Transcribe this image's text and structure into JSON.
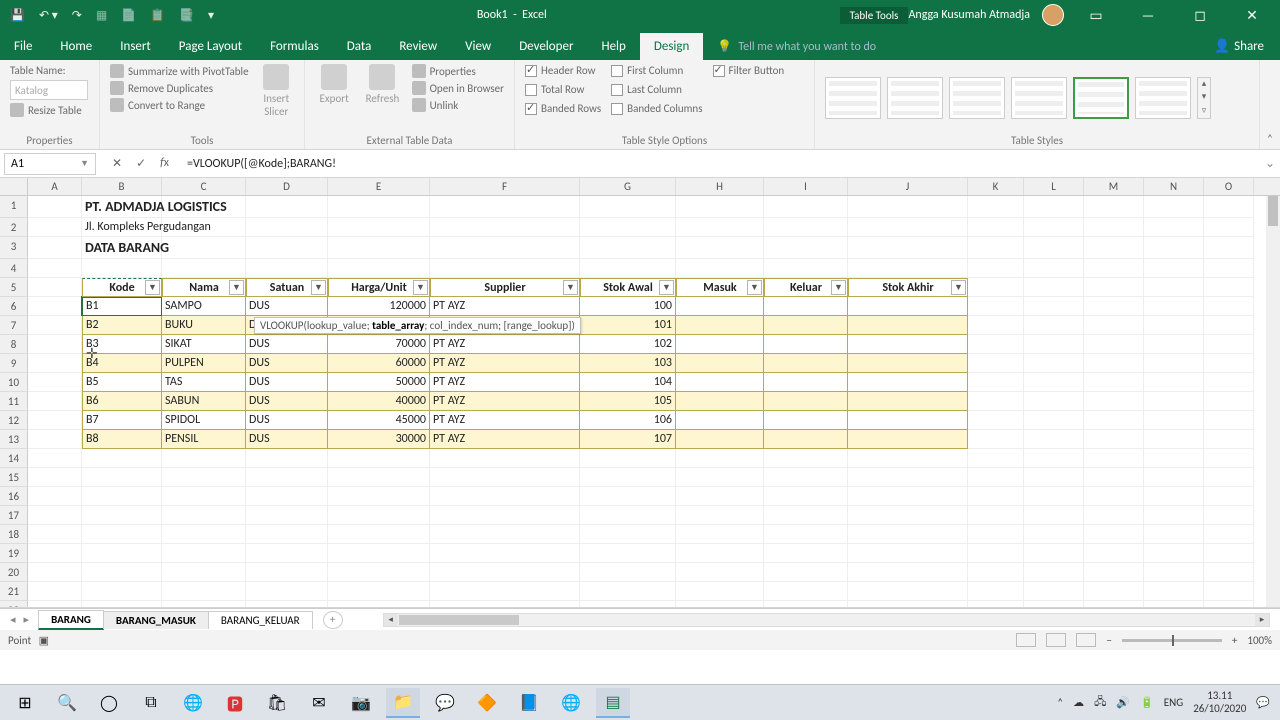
{
  "title": {
    "doc": "Book1",
    "app": "Excel",
    "tools": "Table Tools",
    "user": "Angga Kusumah Atmadja"
  },
  "tabs": [
    "File",
    "Home",
    "Insert",
    "Page Layout",
    "Formulas",
    "Data",
    "Review",
    "View",
    "Developer",
    "Help",
    "Design"
  ],
  "tellme": "Tell me what you want to do",
  "share": "Share",
  "ribbon": {
    "properties": {
      "label": "Properties",
      "tableNameLabel": "Table Name:",
      "tableName": "Katalog",
      "resize": "Resize Table"
    },
    "tools": {
      "label": "Tools",
      "pivot": "Summarize with PivotTable",
      "dup": "Remove Duplicates",
      "range": "Convert to Range",
      "slicer": "Insert Slicer"
    },
    "ext": {
      "label": "External Table Data",
      "export": "Export",
      "refresh": "Refresh",
      "props": "Properties",
      "browser": "Open in Browser",
      "unlink": "Unlink"
    },
    "opts": {
      "label": "Table Style Options",
      "header": "Header Row",
      "total": "Total Row",
      "banded": "Banded Rows",
      "first": "First Column",
      "last": "Last Column",
      "bandedc": "Banded Columns",
      "filter": "Filter Button"
    },
    "styles": {
      "label": "Table Styles"
    }
  },
  "fx": {
    "nameBox": "A1",
    "formula": "=VLOOKUP([@Kode];BARANG!"
  },
  "tooltip": "VLOOKUP(lookup_value; table_array; col_index_num; [range_lookup])",
  "columns": [
    "A",
    "B",
    "C",
    "D",
    "E",
    "F",
    "G",
    "H",
    "I",
    "J",
    "K",
    "L",
    "M",
    "N",
    "O"
  ],
  "sheet": {
    "title": "PT. ADMADJA LOGISTICS",
    "sub": "Jl. Kompleks Pergudangan",
    "section": "DATA BARANG",
    "headers": [
      "Kode",
      "Nama",
      "Satuan",
      "Harga/Unit",
      "Supplier",
      "Stok Awal",
      "Masuk",
      "Keluar",
      "Stok Akhir"
    ],
    "rows": [
      {
        "kode": "B1",
        "nama": "SAMPO",
        "sat": "DUS",
        "harga": "120000",
        "sup": "PT AYZ",
        "stok": "100"
      },
      {
        "kode": "B2",
        "nama": "BUKU",
        "sat": "DUS",
        "harga": "",
        "sup": "",
        "stok": "101"
      },
      {
        "kode": "B3",
        "nama": "SIKAT",
        "sat": "DUS",
        "harga": "70000",
        "sup": "PT AYZ",
        "stok": "102"
      },
      {
        "kode": "B4",
        "nama": "PULPEN",
        "sat": "DUS",
        "harga": "60000",
        "sup": "PT AYZ",
        "stok": "103"
      },
      {
        "kode": "B5",
        "nama": "TAS",
        "sat": "DUS",
        "harga": "50000",
        "sup": "PT AYZ",
        "stok": "104"
      },
      {
        "kode": "B6",
        "nama": "SABUN",
        "sat": "DUS",
        "harga": "40000",
        "sup": "PT AYZ",
        "stok": "105"
      },
      {
        "kode": "B7",
        "nama": "SPIDOL",
        "sat": "DUS",
        "harga": "45000",
        "sup": "PT AYZ",
        "stok": "106"
      },
      {
        "kode": "B8",
        "nama": "PENSIL",
        "sat": "DUS",
        "harga": "30000",
        "sup": "PT AYZ",
        "stok": "107"
      }
    ]
  },
  "sheets": [
    "BARANG",
    "BARANG_MASUK",
    "BARANG_KELUAR"
  ],
  "status": {
    "mode": "Point",
    "zoom": "100%"
  },
  "tray": {
    "time": "13.11",
    "date": "26/10/2020"
  }
}
